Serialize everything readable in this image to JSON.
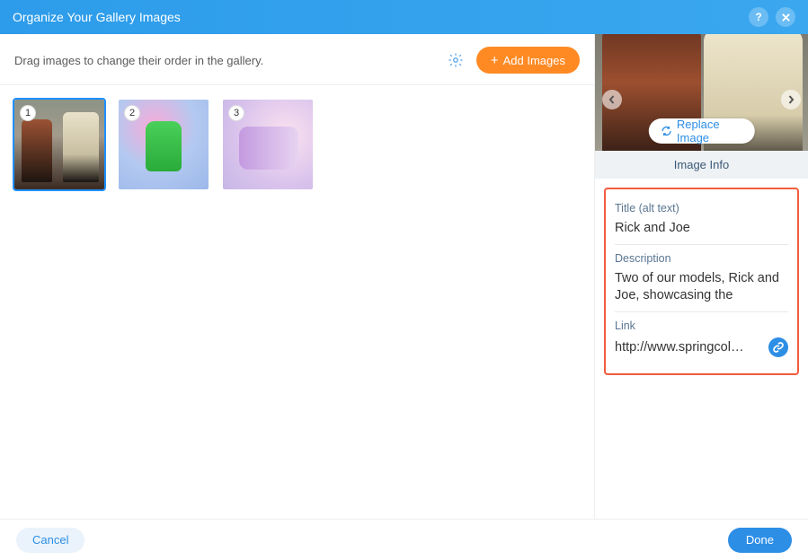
{
  "header": {
    "title": "Organize Your Gallery Images"
  },
  "toolbar": {
    "instruction": "Drag images to change their order in the gallery.",
    "add_label": "Add Images"
  },
  "thumbs": [
    {
      "number": "1",
      "selected": true
    },
    {
      "number": "2",
      "selected": false
    },
    {
      "number": "3",
      "selected": false
    }
  ],
  "preview": {
    "replace_label": "Replace Image",
    "info_header": "Image Info"
  },
  "info": {
    "title_label": "Title (alt text)",
    "title_value": "Rick and Joe",
    "desc_label": "Description",
    "desc_value": "Two of our models, Rick and Joe, showcasing the",
    "link_label": "Link",
    "link_value": "http://www.springcol…"
  },
  "footer": {
    "cancel": "Cancel",
    "done": "Done"
  }
}
